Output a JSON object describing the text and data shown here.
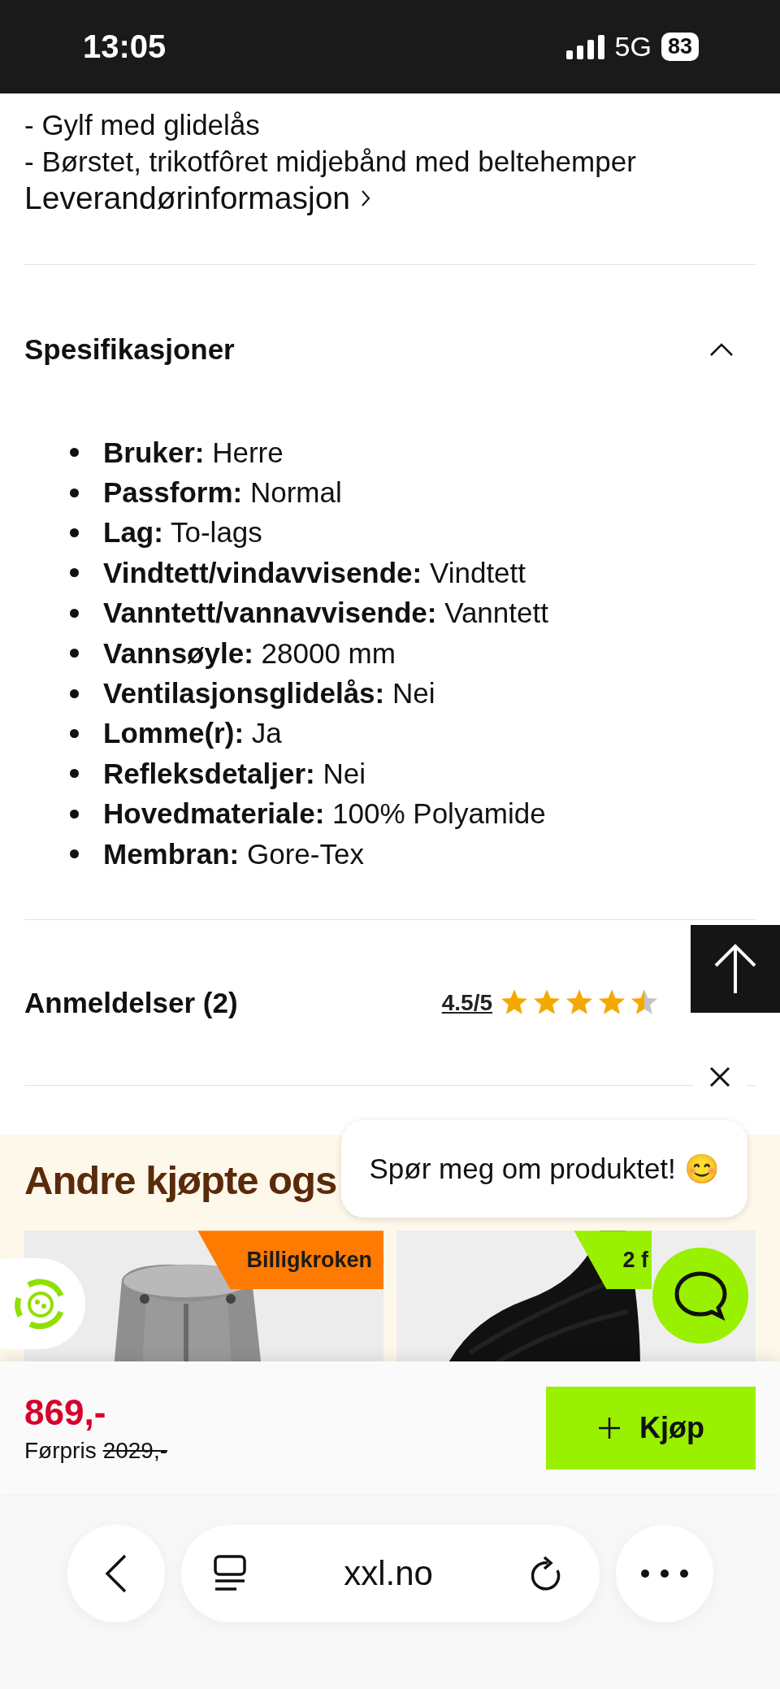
{
  "status_bar": {
    "time": "13:05",
    "network": "5G",
    "battery": "83"
  },
  "description": {
    "lines": [
      "- Gylf med glidelås",
      "- Børstet, trikotfôret midjebånd med beltehemper"
    ],
    "link": "Leverandørinformasjon"
  },
  "specs": {
    "title": "Spesifikasjoner",
    "expanded": true,
    "items": [
      {
        "label": "Bruker:",
        "value": "Herre"
      },
      {
        "label": "Passform:",
        "value": "Normal"
      },
      {
        "label": "Lag:",
        "value": "To-lags"
      },
      {
        "label": "Vindtett/vindavvisende:",
        "value": "Vindtett"
      },
      {
        "label": "Vanntett/vannavvisende:",
        "value": "Vanntett"
      },
      {
        "label": "Vannsøyle:",
        "value": "28000 mm"
      },
      {
        "label": "Ventilasjonsglidelås:",
        "value": "Nei"
      },
      {
        "label": "Lomme(r):",
        "value": "Ja"
      },
      {
        "label": "Refleksdetaljer:",
        "value": "Nei"
      },
      {
        "label": "Hovedmateriale:",
        "value": "100% Polyamide"
      },
      {
        "label": "Membran:",
        "value": "Gore-Tex"
      }
    ]
  },
  "reviews": {
    "title": "Anmeldelser (2)",
    "rating": "4.5/5",
    "stars": 4.5
  },
  "related": {
    "title": "Andre kjøpte ogs",
    "products": [
      {
        "badge": "Billigkroken",
        "color": "#ff7a00",
        "kind": "jacket"
      },
      {
        "badge": "2 f",
        "color": "#99f000",
        "kind": "beanie"
      }
    ]
  },
  "chat": {
    "prompt": "Spør meg om produktet! 😊"
  },
  "buy_bar": {
    "price": "869,-",
    "previous_label": "Førpris",
    "previous_price": "2029,-",
    "button": "Kjøp"
  },
  "browser": {
    "url": "xxl.no"
  }
}
